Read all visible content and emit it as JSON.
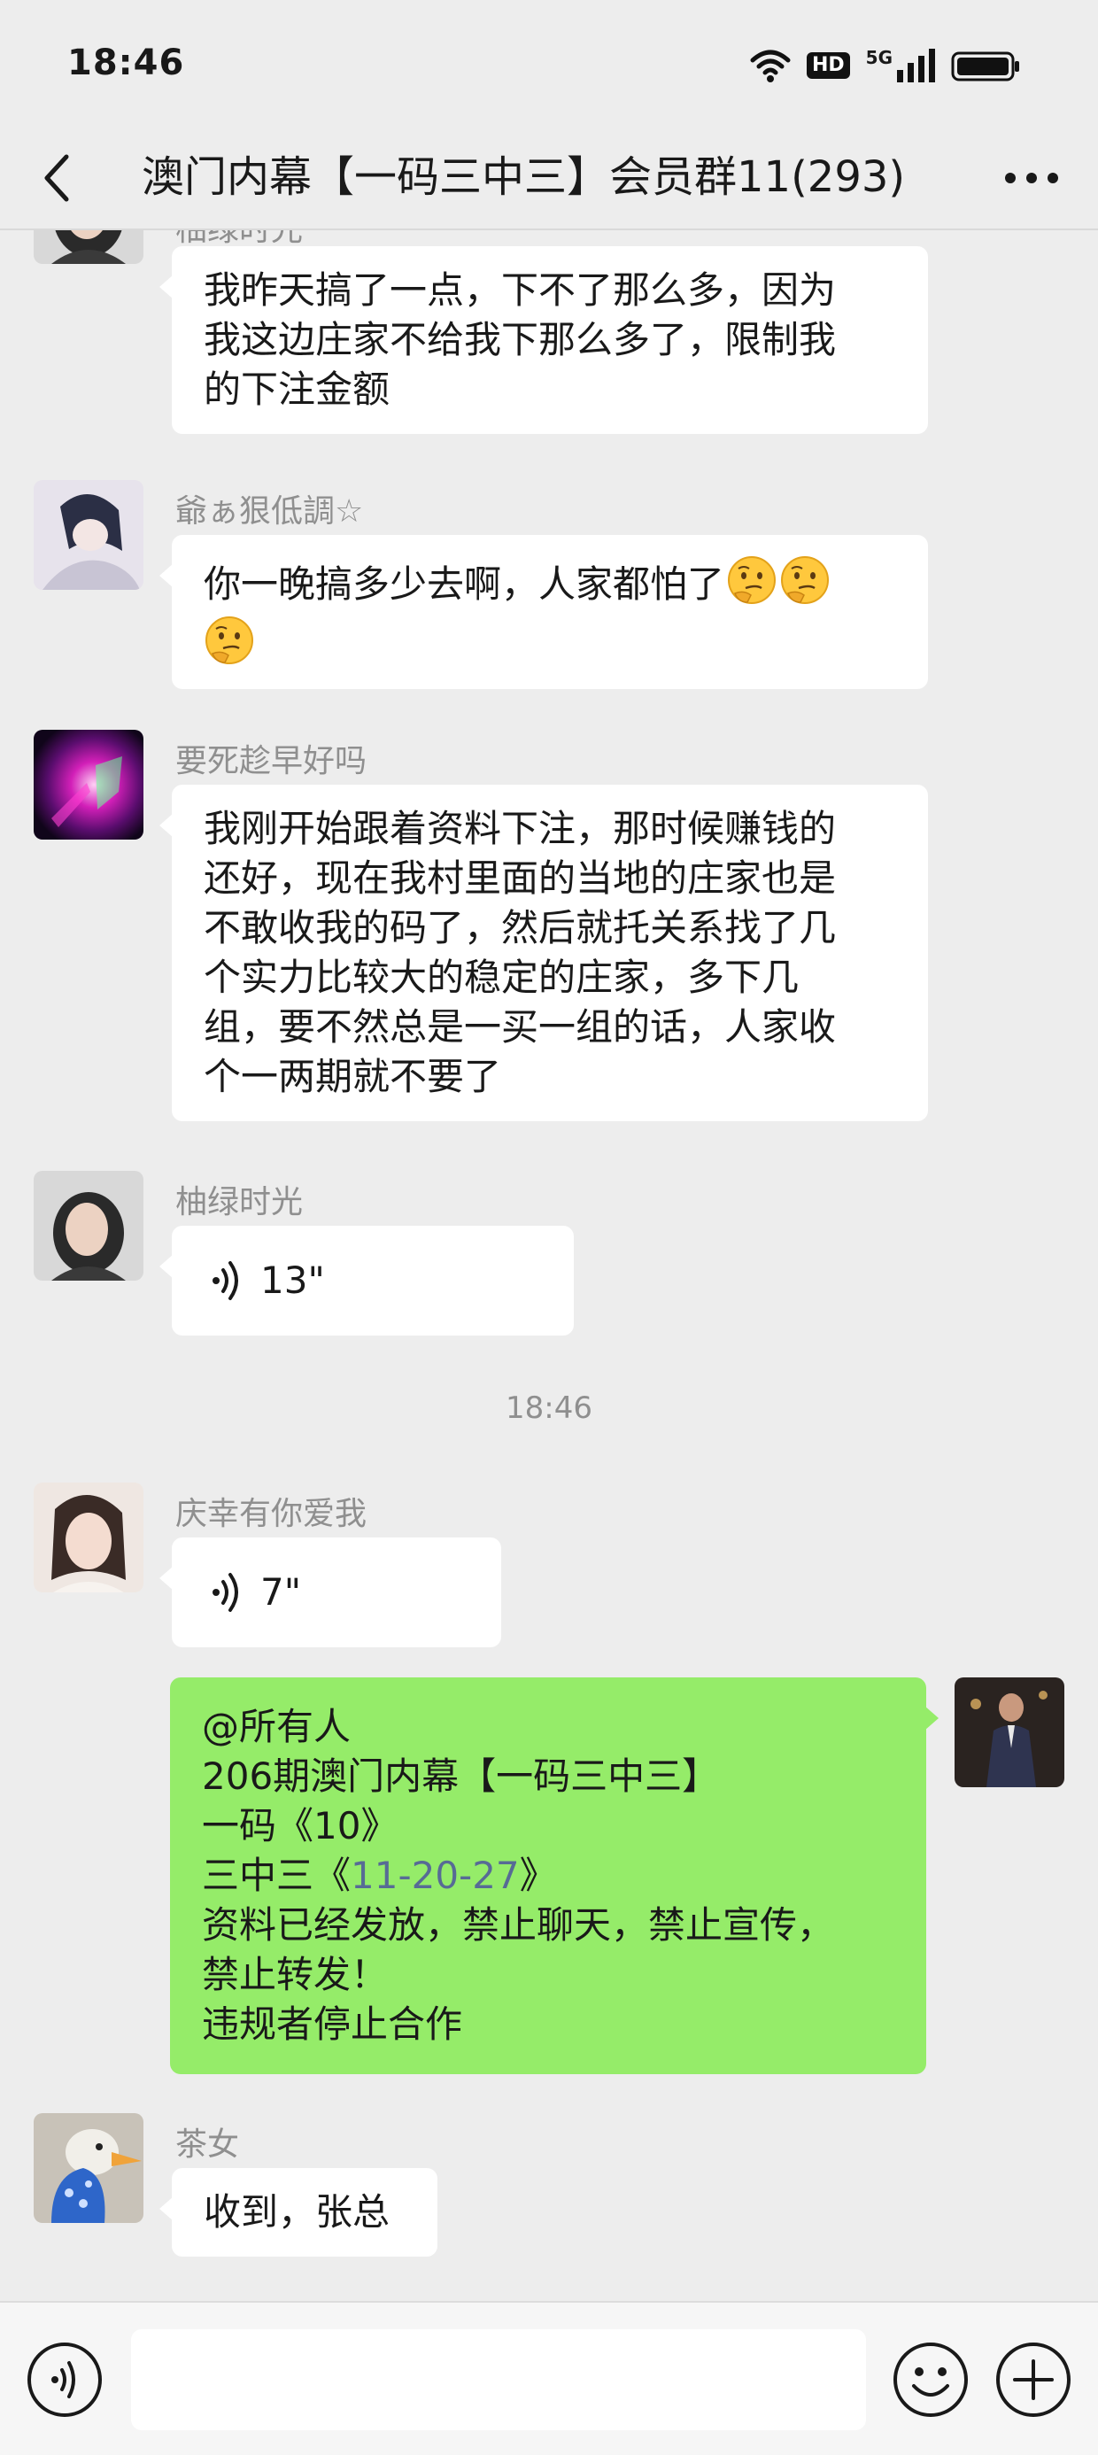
{
  "status_bar": {
    "time": "18:46",
    "hd_label": "HD",
    "network_label": "5G",
    "icons": [
      "wifi-icon",
      "hd-icon",
      "5g-signal-icon",
      "battery-icon"
    ]
  },
  "nav": {
    "title": "澳门内幕【一码三中三】会员群11(293)",
    "back_icon": "chevron-left-icon",
    "more_icon": "more-dots-icon"
  },
  "messages": [
    {
      "sender": "柚绿时光",
      "avatar": "avatar-woman-dark-hair",
      "lines": [
        "我昨天搞了一点，下不了那么多，因为",
        "我这边庄家不给我下那么多了，限制我",
        "的下注金额"
      ]
    },
    {
      "sender": "爺ぁ狠低調☆",
      "avatar": "avatar-anime-girl",
      "lines": [
        "你一晚搞多少去啊，人家都怕了",
        ""
      ],
      "emoji": "thinking-face-emoji"
    },
    {
      "sender": "要死趁早好吗",
      "avatar": "avatar-neon-abstract",
      "lines": [
        "我刚开始跟着资料下注，那时候赚钱的",
        "还好，现在我村里面的当地的庄家也是",
        "不敢收我的码了，然后就托关系找了几",
        "个实力比较大的稳定的庄家，多下几",
        "组，要不然总是一买一组的话，人家收",
        "个一两期就不要了"
      ]
    },
    {
      "sender": "柚绿时光",
      "avatar": "avatar-woman-dark-hair",
      "voice_duration": "13\""
    },
    {
      "sender": "庆幸有你爱我",
      "avatar": "avatar-woman-portrait",
      "voice_duration": "7\""
    },
    {
      "sender": "",
      "avatar": "avatar-man-suit",
      "mine": true,
      "lines": [
        "@所有人",
        "206期澳门内幕【一码三中三】",
        "一码《10》",
        "三中三《",
        "资料已经发放，禁止聊天，禁止宣传，",
        "禁止转发！",
        "违规者停止合作"
      ],
      "link_number": "11-20-27",
      "link_suffix": "》"
    },
    {
      "sender": "茶女",
      "avatar": "avatar-blue-bird",
      "lines": [
        "收到，张总"
      ]
    }
  ],
  "time_divider": "18:46",
  "input_bar": {
    "voice_icon": "voice-mode-icon",
    "emoji_icon": "emoji-face-icon",
    "plus_icon": "plus-circle-icon",
    "placeholder": ""
  },
  "colors": {
    "background": "#ededed",
    "bubble_incoming": "#ffffff",
    "bubble_outgoing": "#95ec69",
    "link": "#576b95",
    "meta_text": "#8f8f8f"
  }
}
